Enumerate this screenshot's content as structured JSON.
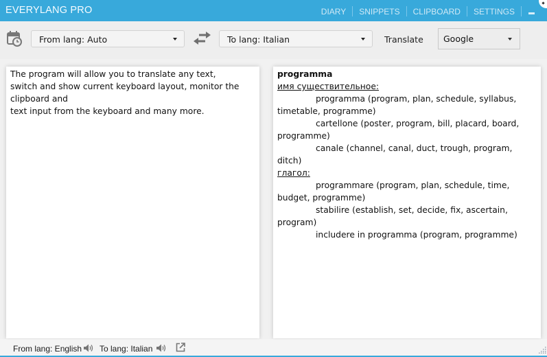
{
  "app": {
    "title": "EVERYLANG PRO"
  },
  "nav": {
    "items": [
      {
        "label": "DIARY"
      },
      {
        "label": "SNIPPETS"
      },
      {
        "label": "CLIPBOARD"
      },
      {
        "label": "SETTINGS"
      }
    ],
    "minimize_icon": "minimize-icon"
  },
  "toolbar": {
    "history_icon": "calendar-clock-icon",
    "from_select": {
      "value": "From lang: Auto"
    },
    "swap_icon": "swap-arrows-icon",
    "to_select": {
      "value": "To lang: Italian"
    },
    "translate_label": "Translate",
    "engine_select": {
      "value": "Google"
    }
  },
  "source": {
    "lines": [
      "The program will allow you to translate any text,",
      "switch and show current keyboard layout, monitor the",
      "clipboard and",
      "text input from the keyboard and many more."
    ]
  },
  "result": {
    "word": "programma",
    "groups": [
      {
        "pos": "имя существительное:",
        "entries": [
          "programma (program, plan, schedule, syllabus, timetable, programme)",
          "cartellone (poster, program, bill, placard, board, programme)",
          "canale (channel, canal, duct, trough, program, ditch)"
        ]
      },
      {
        "pos": "глагол:",
        "entries": [
          "programmare (program, plan, schedule, time, budget, programme)",
          "stabilire (establish, set, decide, fix, ascertain, program)",
          "includere in programma (program, programme)"
        ]
      }
    ]
  },
  "footer": {
    "from_label": "From lang: English",
    "to_label": "To lang: Italian",
    "speaker_icon": "speaker-icon",
    "open_external_icon": "open-external-icon"
  },
  "colors": {
    "accent": "#38a9db",
    "background": "#eeeeee",
    "panel": "#ffffff"
  }
}
